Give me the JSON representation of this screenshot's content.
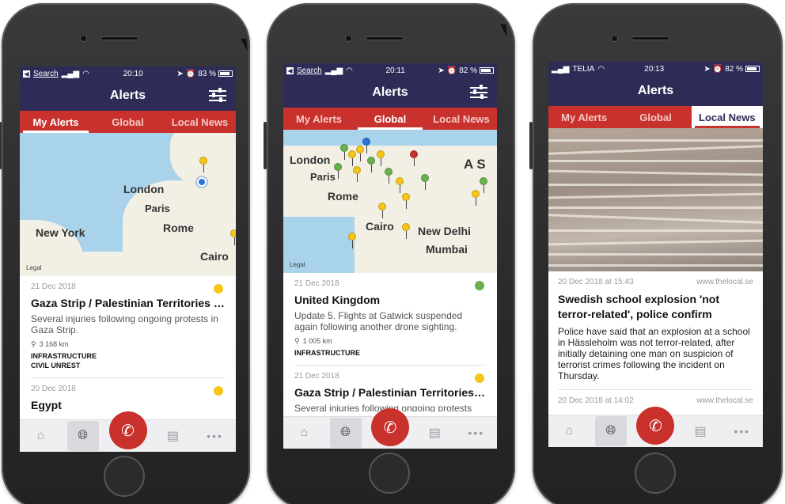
{
  "phones": [
    {
      "status": {
        "carrier": "Search",
        "time": "20:10",
        "battery": "83 %"
      },
      "title": "Alerts",
      "tabs": [
        "My Alerts",
        "Global",
        "Local News"
      ],
      "active_tab": "My Alerts",
      "map": {
        "labels": [
          "London",
          "Paris",
          "Rome",
          "Cairo",
          "New York"
        ],
        "legal": "Legal"
      },
      "alerts": [
        {
          "date": "21 Dec 2018",
          "severity_color": "#f5c518",
          "headline": "Gaza Strip / Palestinian Territories / Is...",
          "description": "Several injuries following ongoing protests in Gaza Strip.",
          "distance": "3 168 km",
          "categories": [
            "INFRASTRUCTURE",
            "CIVIL UNREST"
          ]
        },
        {
          "date": "20 Dec 2018",
          "severity_color": "#f5c518",
          "headline": "Egypt"
        }
      ]
    },
    {
      "status": {
        "carrier": "Search",
        "time": "20:11",
        "battery": "82 %"
      },
      "title": "Alerts",
      "tabs": [
        "My Alerts",
        "Global",
        "Local News"
      ],
      "active_tab": "Global",
      "map": {
        "labels": [
          "London",
          "Paris",
          "Rome",
          "Cairo",
          "New Delhi",
          "Mumbai",
          "A S"
        ],
        "legal": "Legal"
      },
      "alerts": [
        {
          "date": "21 Dec 2018",
          "severity_color": "#6ab04c",
          "headline": "United Kingdom",
          "description": "Update 5. Flights at Gatwick suspended again following another drone sighting.",
          "distance": "1 005 km",
          "categories": [
            "INFRASTRUCTURE"
          ]
        },
        {
          "date": "21 Dec 2018",
          "severity_color": "#f5c518",
          "headline": "Gaza Strip / Palestinian Territories / Is...",
          "description": "Several injuries following ongoing protests"
        }
      ]
    },
    {
      "status": {
        "carrier": "TELIA",
        "time": "20:13",
        "battery": "82 %"
      },
      "title": "Alerts",
      "tabs": [
        "My Alerts",
        "Global",
        "Local News"
      ],
      "active_tab": "Local News",
      "news": [
        {
          "date": "20 Dec 2018 at 15:43",
          "source": "www.thelocal.se",
          "headline": "Swedish school explosion 'not terror-related', police confirm",
          "body": "Police have said that an explosion at a school in Hässleholm was not terror-related, after initially detaining one man on suspicion of terrorist crimes following the incident on Thursday."
        },
        {
          "date": "20 Dec 2018 at 14:02",
          "source": "www.thelocal.se"
        }
      ]
    }
  ],
  "tabbar_icons": [
    "home-icon",
    "globe-icon",
    "phone-call-icon",
    "news-icon",
    "more-icon"
  ]
}
